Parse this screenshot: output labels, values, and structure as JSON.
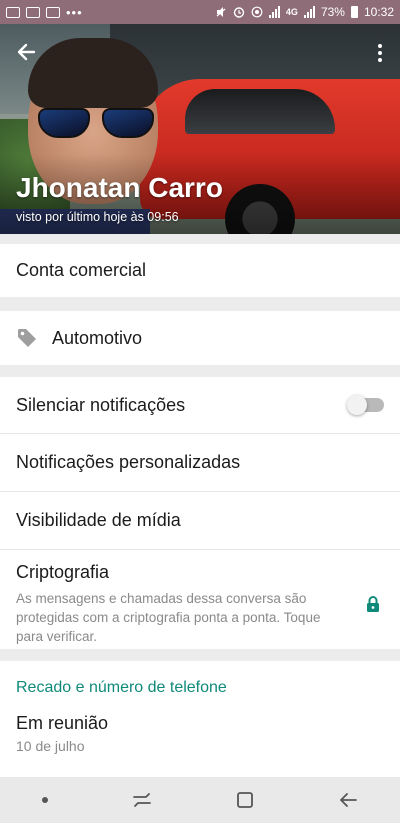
{
  "status_bar": {
    "battery": "73%",
    "time": "10:32",
    "network": "4G",
    "more": "•••"
  },
  "header": {
    "name": "Jhonatan Carro",
    "last_seen": "visto por último hoje às 09:56"
  },
  "business": {
    "label": "Conta comercial",
    "category": "Automotivo"
  },
  "settings": {
    "mute": "Silenciar notificações",
    "mute_enabled": false,
    "custom_notifications": "Notificações personalizadas",
    "media_visibility": "Visibilidade de mídia",
    "encryption_title": "Criptografia",
    "encryption_desc": "As mensagens e chamadas dessa conversa são protegidas com a criptografia ponta a ponta. Toque para verificar."
  },
  "about": {
    "section_title": "Recado e número de telefone",
    "status": "Em reunião",
    "date": "10 de julho"
  },
  "colors": {
    "accent": "#0f8a7a",
    "status_bar": "#8e6d79"
  }
}
